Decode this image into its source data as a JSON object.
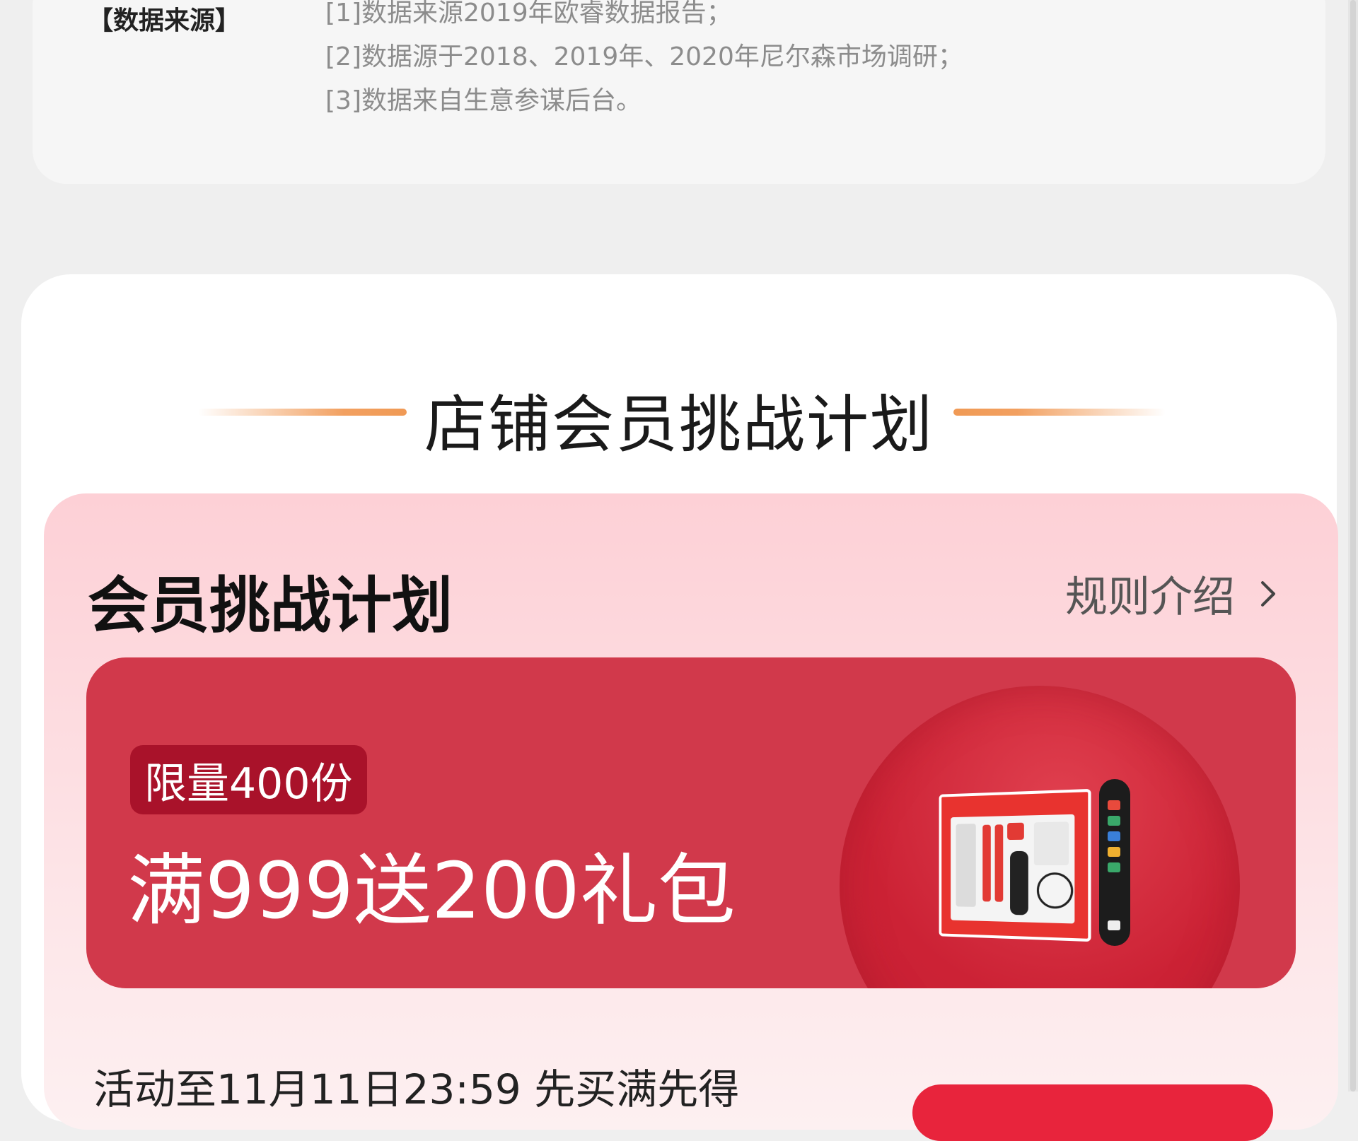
{
  "data_source": {
    "label": "【数据来源】",
    "lines": [
      "[1]数据来源2019年欧睿数据报告；",
      "[2]数据源于2018、2019年、2020年尼尔森市场调研；",
      "[3]数据来自生意参谋后台。"
    ]
  },
  "section": {
    "title": "店铺会员挑战计划"
  },
  "challenge": {
    "title": "会员挑战计划",
    "rules_label": "规则介绍",
    "limit_badge": "限量400份",
    "offer": "满999送200礼包",
    "activity_text": "活动至11月11日23:59 先买满先得"
  },
  "colors": {
    "accent_red": "#d1394b",
    "badge_red": "#a9122a",
    "accent_orange": "#f09a55",
    "pink_bg": "#fdd0d6"
  },
  "icons": {
    "rules_chevron": "chevron-right-icon"
  }
}
